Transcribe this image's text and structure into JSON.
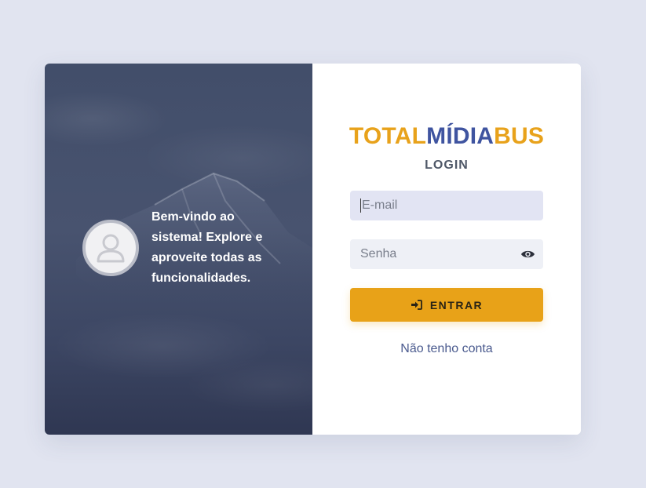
{
  "hero": {
    "welcome_text": "Bem-vindo ao sistema! Explore e aproveite todas as funcionalidades."
  },
  "brand": {
    "part1": "TOTAL",
    "part2": "MÍDIA",
    "part3": "BUS",
    "color_primary": "#e8a21b",
    "color_secondary": "#3f54a0"
  },
  "form": {
    "title": "LOGIN",
    "email": {
      "placeholder": "E-mail",
      "value": ""
    },
    "password": {
      "placeholder": "Senha",
      "value": "",
      "toggle_icon": "eye-icon"
    },
    "submit": {
      "label": "ENTRAR",
      "icon": "sign-in-icon"
    },
    "signup_link": "Não tenho conta"
  },
  "colors": {
    "background": "#e1e4f0",
    "button": "#e8a218",
    "hero": "#424e6a"
  }
}
